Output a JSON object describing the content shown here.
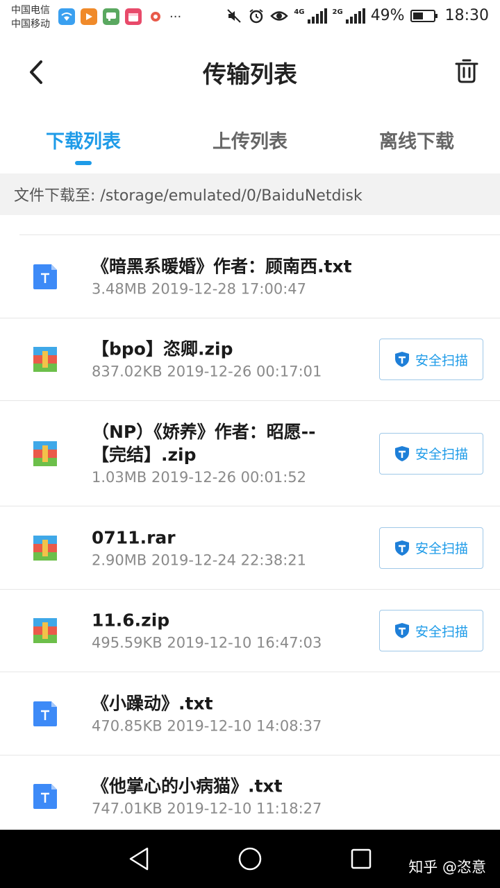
{
  "status_bar": {
    "carrier_1": "中国电信",
    "carrier_2": "中国移动",
    "more_indicator": "···",
    "net_1": "4G",
    "net_2": "2G",
    "battery": "49%",
    "battery_level": 0.49,
    "time": "18:30"
  },
  "header": {
    "title": "传输列表"
  },
  "tabs": [
    {
      "label": "下载列表",
      "active": true
    },
    {
      "label": "上传列表",
      "active": false
    },
    {
      "label": "离线下载",
      "active": false
    }
  ],
  "path_bar": {
    "text": "文件下载至: /storage/emulated/0/BaiduNetdisk"
  },
  "files": [
    {
      "name": "《暗黑系暖婚》作者：顾南西.txt",
      "meta": "3.48MB 2019-12-28 17:00:47",
      "type": "txt-icon",
      "scan": false
    },
    {
      "name": "【bpo】恣卿.zip",
      "meta": "837.02KB 2019-12-26 00:17:01",
      "type": "zip-icon",
      "scan": true
    },
    {
      "name": "（NP）《娇养》作者：昭愿--【完结】.zip",
      "meta": "1.03MB 2019-12-26 00:01:52",
      "type": "zip-icon",
      "scan": true
    },
    {
      "name": "0711.rar",
      "meta": "2.90MB 2019-12-24 22:38:21",
      "type": "zip-icon",
      "scan": true
    },
    {
      "name": "11.6.zip",
      "meta": "495.59KB 2019-12-10 16:47:03",
      "type": "zip-icon",
      "scan": true
    },
    {
      "name": "《小躁动》.txt",
      "meta": "470.85KB 2019-12-10 14:08:37",
      "type": "txt-icon",
      "scan": false
    },
    {
      "name": "《他掌心的小病猫》.txt",
      "meta": "747.01KB 2019-12-10 11:18:27",
      "type": "txt-icon",
      "scan": false
    }
  ],
  "scan_label": "安全扫描",
  "watermark": "知乎 @恣意",
  "colors": {
    "accent": "#1e9be8",
    "txt_icon": "#3d8af7"
  }
}
